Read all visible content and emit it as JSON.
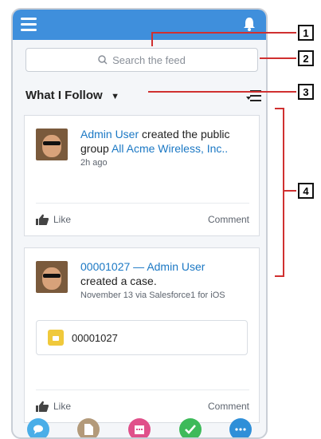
{
  "search": {
    "placeholder": "Search the feed"
  },
  "feed_filter": {
    "label": "What I Follow"
  },
  "posts": [
    {
      "author": "Admin User",
      "action": " created the public group ",
      "target": "All Acme Wireless, Inc..",
      "time": "2h ago",
      "like_label": "Like",
      "comment_label": "Comment"
    },
    {
      "case_number": "00001027",
      "separator": " — ",
      "author": "Admin User",
      "action": "created a case.",
      "meta": "November 13 via Salesforce1 for iOS",
      "attachment_label": "00001027",
      "like_label": "Like",
      "comment_label": "Comment"
    }
  ],
  "callouts": [
    "1",
    "2",
    "3",
    "4"
  ],
  "colors": {
    "header": "#3f8fdc",
    "link": "#1b78c4",
    "annotation_line": "#d03030"
  }
}
